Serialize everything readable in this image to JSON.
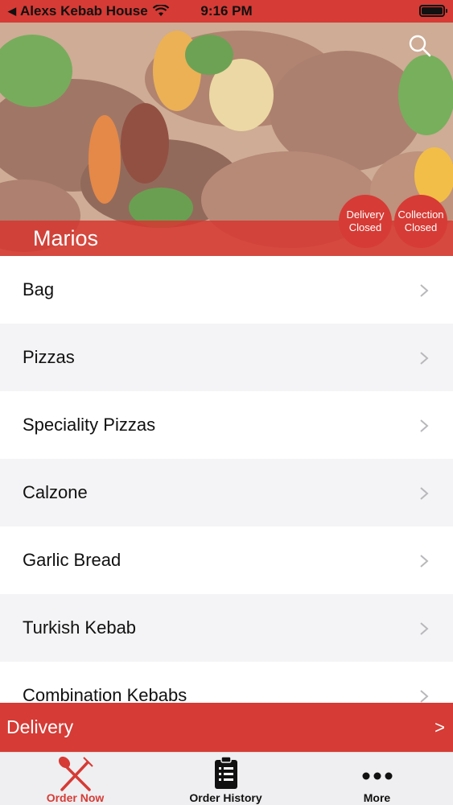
{
  "status_bar": {
    "back_app": "Alexs Kebab House",
    "time": "9:16 PM",
    "back_icon": "back-triangle-icon",
    "wifi_icon": "wifi-icon",
    "battery_icon": "battery-icon"
  },
  "header": {
    "restaurant_name": "Marios",
    "search_icon": "search-icon",
    "delivery_status": {
      "line1": "Delivery",
      "line2": "Closed"
    },
    "collection_status": {
      "line1": "Collection",
      "line2": "Closed"
    },
    "accent_color": "#d63b35"
  },
  "menu": {
    "categories": [
      "Bag",
      "Pizzas",
      "Speciality Pizzas",
      "Calzone",
      "Garlic Bread",
      "Turkish Kebab",
      "Combination Kebabs"
    ]
  },
  "delivery_bar": {
    "label": "Delivery",
    "arrow": ">"
  },
  "tabs": [
    {
      "label": "Order Now",
      "icon": "fork-knife-icon",
      "active": true
    },
    {
      "label": "Order History",
      "icon": "clipboard-list-icon",
      "active": false
    },
    {
      "label": "More",
      "icon": "more-dots-icon",
      "active": false
    }
  ]
}
